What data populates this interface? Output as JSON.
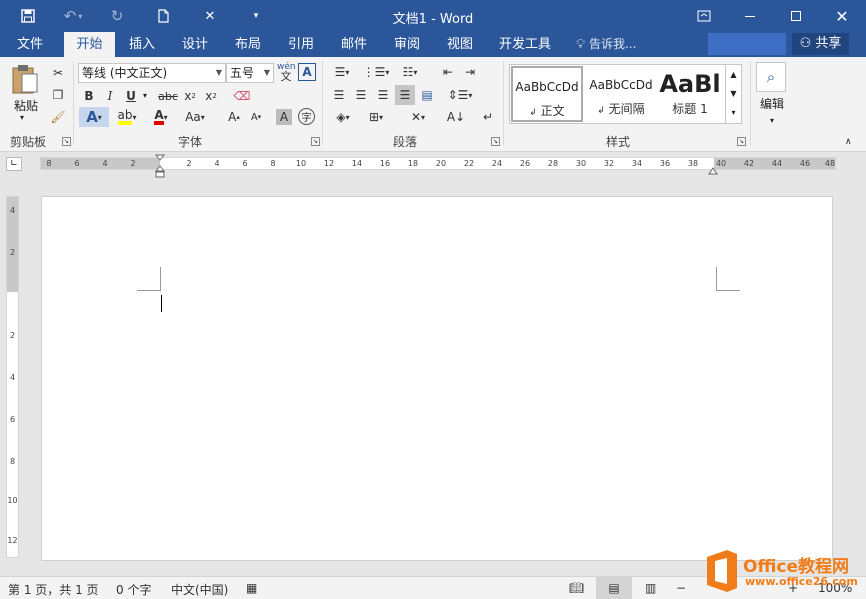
{
  "window": {
    "title": "文档1 - Word",
    "minimize_icon": "minimize-icon",
    "restore_icon": "restore-icon",
    "close_icon": "close-icon",
    "ribbon_display_icon": "ribbon-display-options-icon"
  },
  "quick_access": {
    "save_icon": "save-icon",
    "undo_icon": "undo-icon",
    "redo_icon": "redo-icon",
    "new_icon": "new-document-icon",
    "touch_icon": "touch-mode-icon",
    "customize_icon": "customize-toolbar-icon"
  },
  "tabs": [
    {
      "label": "文件"
    },
    {
      "label": "开始"
    },
    {
      "label": "插入"
    },
    {
      "label": "设计"
    },
    {
      "label": "布局"
    },
    {
      "label": "引用"
    },
    {
      "label": "邮件"
    },
    {
      "label": "审阅"
    },
    {
      "label": "视图"
    },
    {
      "label": "开发工具"
    }
  ],
  "active_tab": "开始",
  "tell_me": "告诉我...",
  "share": "共享",
  "ribbon": {
    "clipboard": {
      "group_label": "剪贴板",
      "paste_label": "粘贴"
    },
    "font": {
      "group_label": "字体",
      "font_name": "等线 (中文正文)",
      "font_size": "五号",
      "phonetic_label": "wén"
    },
    "paragraph": {
      "group_label": "段落"
    },
    "styles": {
      "group_label": "样式",
      "items": [
        {
          "preview": "AaBbCcDd",
          "name": "正文"
        },
        {
          "preview": "AaBbCcDd",
          "name": "无间隔"
        },
        {
          "preview": "AaBl",
          "name": "标题 1"
        }
      ]
    },
    "editing": {
      "label": "编辑"
    }
  },
  "ruler": {
    "labels": [
      "8",
      "6",
      "4",
      "2",
      "2",
      "4",
      "6",
      "8",
      "10",
      "12",
      "14",
      "16",
      "18",
      "20",
      "22",
      "24",
      "26",
      "28",
      "30",
      "32",
      "34",
      "36",
      "38",
      "40",
      "42",
      "44",
      "46",
      "48"
    ]
  },
  "vruler": {
    "labels": [
      "4",
      "2",
      "2",
      "4",
      "6",
      "8",
      "10",
      "12"
    ]
  },
  "status": {
    "page": "第 1 页，共 1 页",
    "words": "0 个字",
    "language": "中文(中国)",
    "zoom": "100%"
  },
  "watermark": {
    "brand": "Office教程网",
    "url": "www.office26.com"
  },
  "colors": {
    "accent": "#2b579a",
    "highlight": "#ffff00",
    "font_color": "#e00000",
    "watermark": "#f07d1a"
  }
}
